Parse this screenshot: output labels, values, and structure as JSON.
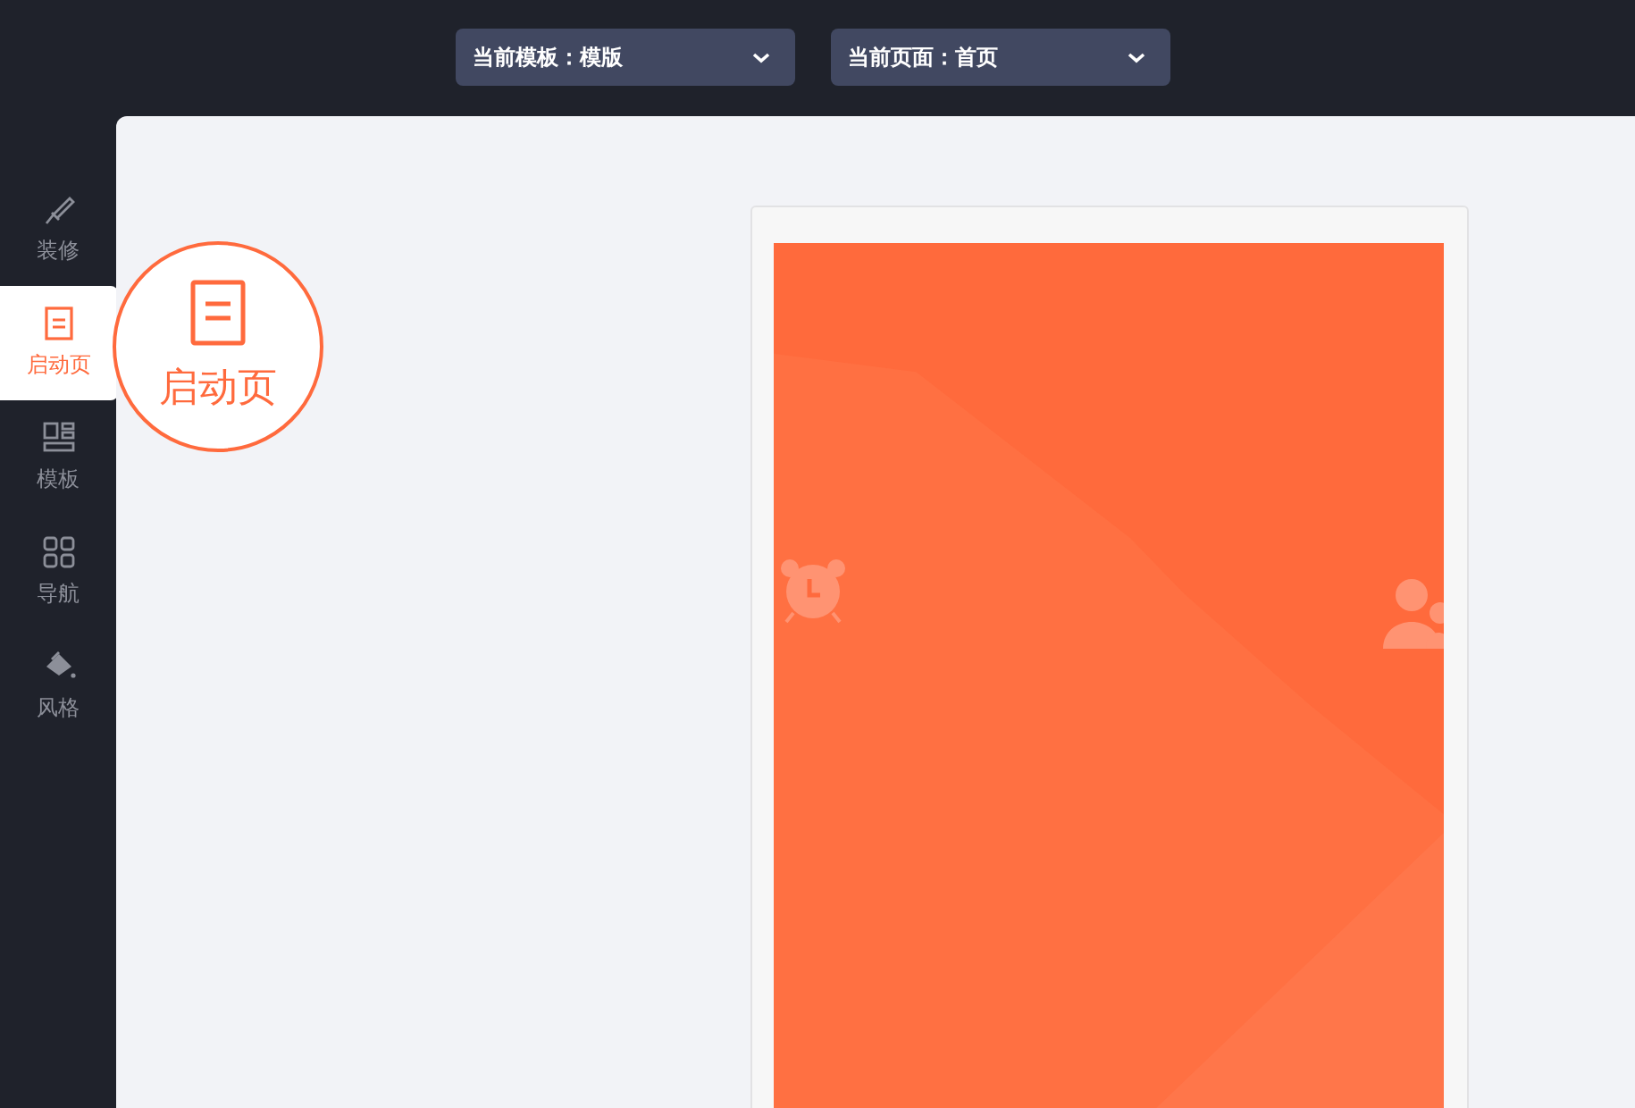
{
  "toolbar": {
    "selectors": [
      {
        "label": "当前模板：模版"
      },
      {
        "label": "当前页面：首页"
      }
    ]
  },
  "sidebar": {
    "items": [
      {
        "label": "装修",
        "selected": false
      },
      {
        "label": "启动页",
        "selected": true
      },
      {
        "label": "模板",
        "selected": false
      },
      {
        "label": "导航",
        "selected": false
      },
      {
        "label": "风格",
        "selected": false
      }
    ]
  },
  "callout": {
    "label": "启动页"
  }
}
